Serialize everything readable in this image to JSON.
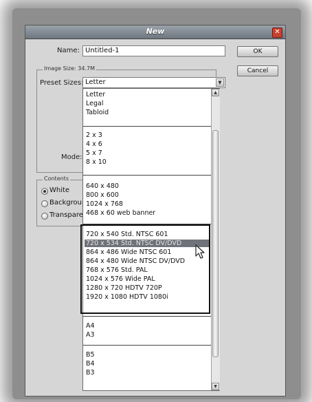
{
  "window": {
    "title": "New"
  },
  "form": {
    "name_label": "Name:",
    "name_value": "Untitled-1",
    "image_size_label": "Image Size: 34.7M",
    "preset_label": "Preset Sizes:",
    "preset_value": "Letter",
    "mode_label": "Mode:"
  },
  "buttons": {
    "ok": "OK",
    "cancel": "Cancel"
  },
  "contents": {
    "title": "Contents",
    "options": [
      "White",
      "Backgroun",
      "Transpare"
    ]
  },
  "dropdown": {
    "groups": [
      [
        "Letter",
        "Legal",
        "Tabloid"
      ],
      [
        "2 x 3",
        "4 x 6",
        "5 x 7",
        "8 x 10"
      ],
      [
        "640 x 480",
        "800 x 600",
        "1024 x 768",
        "468 x 60 web banner"
      ],
      [
        "720 x 540 Std. NTSC 601",
        "720 x 534 Std. NTSC DV/DVD",
        "864 x 486 Wide NTSC 601",
        "864 x 480 Wide NTSC DV/DVD",
        "768 x 576 Std. PAL",
        "1024 x 576 Wide PAL",
        "1280 x 720 HDTV 720P",
        "1920 x 1080 HDTV 1080i"
      ],
      [
        "A4",
        "A3"
      ],
      [
        "B5",
        "B4",
        "B3"
      ]
    ]
  },
  "colors": {
    "highlight": "#6f7278",
    "title_bar": "#7d858d",
    "close": "#c8402e"
  },
  "icons": {
    "close": "close-icon",
    "arrow": "chevron-down-icon",
    "cursor": "arrow-cursor-icon"
  }
}
